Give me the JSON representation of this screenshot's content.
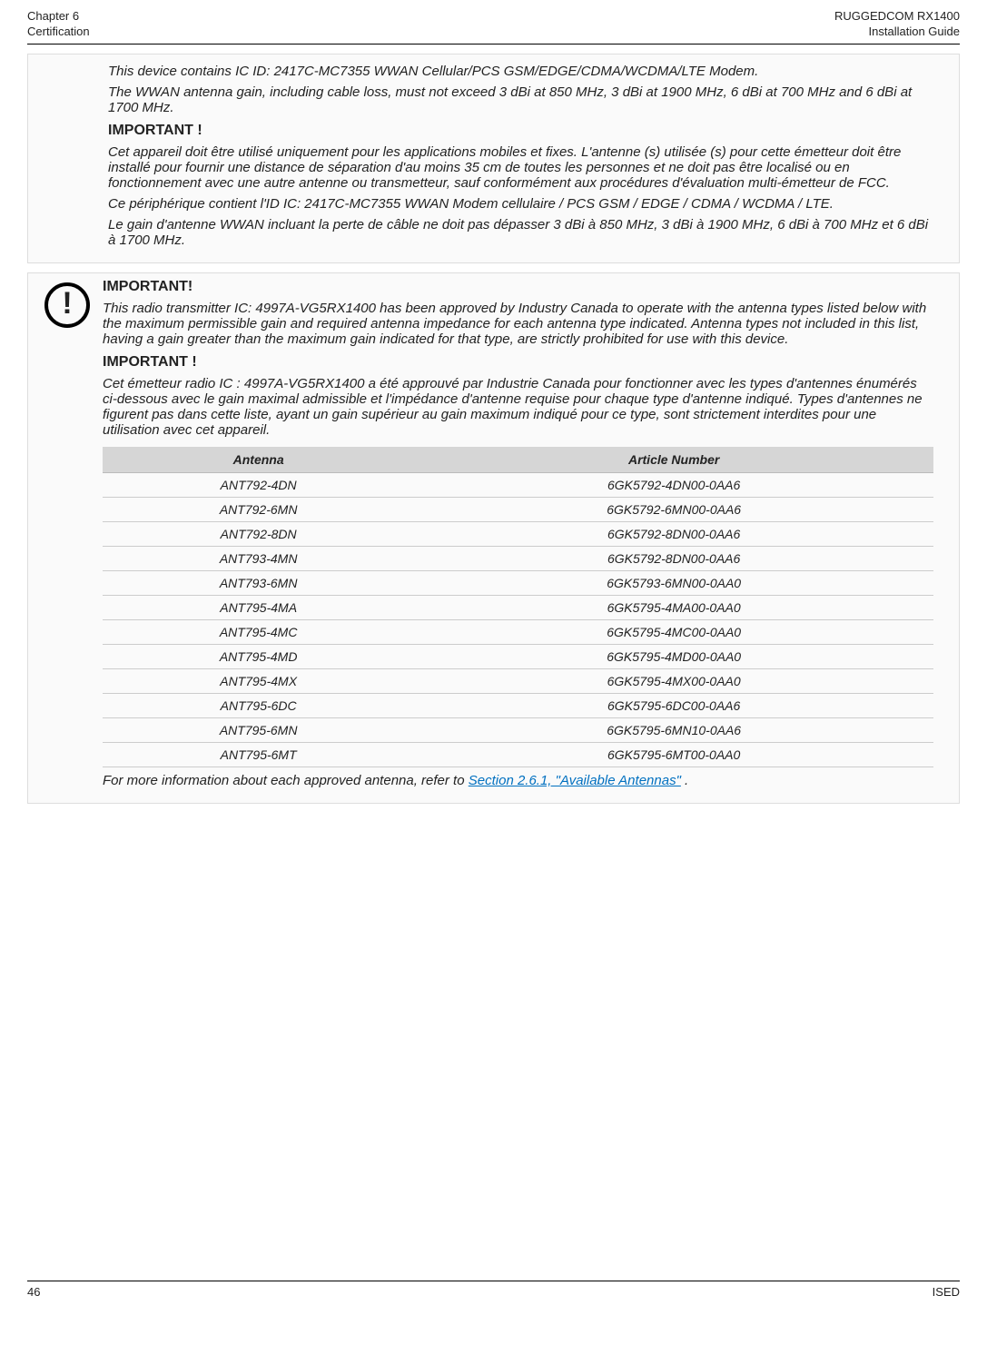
{
  "header": {
    "left_top": "Chapter 6",
    "left_bottom": "Certification",
    "right_top": "RUGGEDCOM RX1400",
    "right_bottom": "Installation Guide"
  },
  "callout1": {
    "p1": "This device contains IC ID: 2417C-MC7355 WWAN Cellular/PCS GSM/EDGE/CDMA/WCDMA/LTE Modem.",
    "p2": "The WWAN antenna gain, including cable loss, must not exceed 3 dBi at 850 MHz, 3 dBi at 1900 MHz, 6 dBi at 700 MHz and 6 dBi at 1700 MHz.",
    "head1": "IMPORTANT !",
    "p3": "Cet appareil doit être utilisé uniquement pour les applications mobiles et fixes. L'antenne (s) utilisée (s) pour cette émetteur doit être installé pour fournir une distance de séparation d'au moins 35 cm de toutes les personnes et ne doit pas être localisé ou en fonctionnement avec une autre antenne ou transmetteur, sauf conformément aux procédures d'évaluation multi-émetteur de FCC.",
    "p4": "Ce périphérique contient l'ID IC: 2417C-MC7355 WWAN Modem cellulaire / PCS GSM / EDGE / CDMA / WCDMA / LTE.",
    "p5": "Le gain d'antenne WWAN incluant la perte de câble ne doit pas dépasser 3 dBi à 850 MHz, 3 dBi à 1900 MHz, 6 dBi à 700 MHz et 6 dBi à 1700 MHz."
  },
  "callout2": {
    "head0": "IMPORTANT!",
    "p1": "This radio transmitter IC: 4997A-VG5RX1400 has been approved by Industry Canada to operate with the antenna types listed below with the maximum permissible gain and required antenna impedance for each antenna type indicated. Antenna types not included in this list, having a gain greater than the maximum gain indicated for that type, are strictly prohibited for use with this device.",
    "head1": "IMPORTANT !",
    "p2": "Cet émetteur radio IC : 4997A-VG5RX1400 a été approuvé par Industrie Canada pour fonctionner avec les types d'antennes énumérés ci-dessous avec le gain maximal admissible et l'impédance d'antenne requise pour chaque type d'antenne indiqué. Types d'antennes ne figurent pas dans cette liste, ayant un gain supérieur au gain maximum indiqué pour ce type, sont strictement interdites pour une utilisation avec cet appareil.",
    "table": {
      "col1": "Antenna",
      "col2": "Article Number",
      "rows": [
        {
          "a": "ANT792-4DN",
          "n": "6GK5792-4DN00-0AA6"
        },
        {
          "a": "ANT792-6MN",
          "n": "6GK5792-6MN00-0AA6"
        },
        {
          "a": "ANT792-8DN",
          "n": "6GK5792-8DN00-0AA6"
        },
        {
          "a": "ANT793-4MN",
          "n": "6GK5792-8DN00-0AA6"
        },
        {
          "a": "ANT793-6MN",
          "n": "6GK5793-6MN00-0AA0"
        },
        {
          "a": "ANT795-4MA",
          "n": "6GK5795-4MA00-0AA0"
        },
        {
          "a": "ANT795-4MC",
          "n": "6GK5795-4MC00-0AA0"
        },
        {
          "a": "ANT795-4MD",
          "n": "6GK5795-4MD00-0AA0"
        },
        {
          "a": "ANT795-4MX",
          "n": "6GK5795-4MX00-0AA0"
        },
        {
          "a": "ANT795-6DC",
          "n": "6GK5795-6DC00-0AA6"
        },
        {
          "a": "ANT795-6MN",
          "n": "6GK5795-6MN10-0AA6"
        },
        {
          "a": "ANT795-6MT",
          "n": "6GK5795-6MT00-0AA0"
        }
      ]
    },
    "more_prefix": "For more information about each approved antenna, refer to  ",
    "more_link": "Section 2.6.1, \"Available Antennas\"",
    "more_suffix": " ."
  },
  "footer": {
    "left": "46",
    "right": "ISED"
  }
}
